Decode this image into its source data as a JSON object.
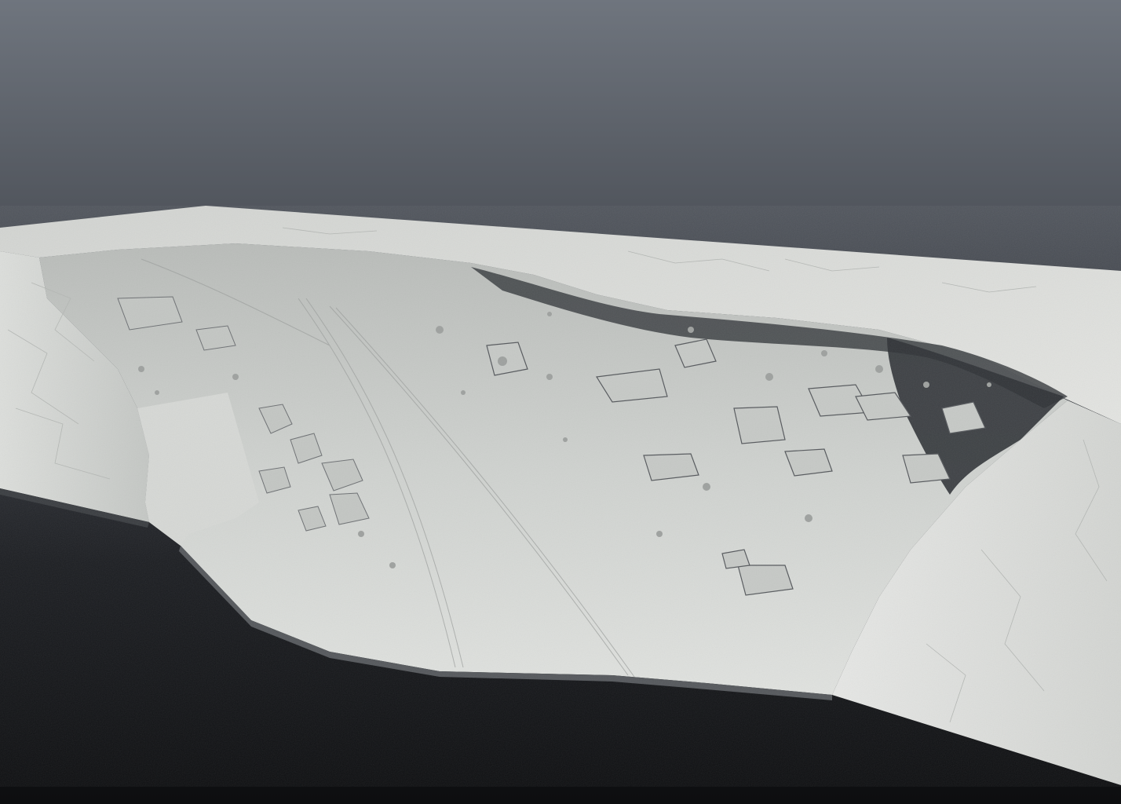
{
  "viewport": {
    "background_top": "#6f757e",
    "background_bottom": "#0d0e10",
    "surface_color": "#d9dbd8",
    "shadow_color": "#2a2d31"
  },
  "scene": {
    "subject": "3d-terrain-mesh",
    "render_style": "grey-shaded-sculpt"
  }
}
